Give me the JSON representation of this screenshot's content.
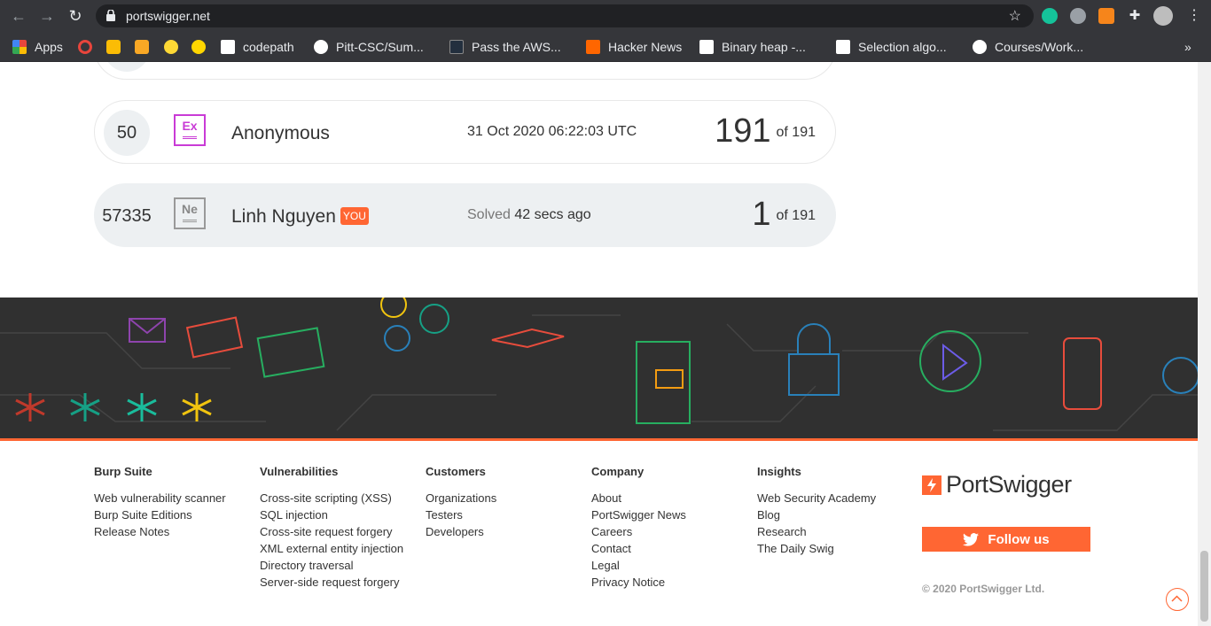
{
  "browser": {
    "url": "portswigger.net",
    "bookmarks": [
      {
        "label": "Apps",
        "color": "#e8453c"
      },
      {
        "label": "codepath",
        "color": "#ffffff"
      },
      {
        "label": "Pitt-CSC/Sum...",
        "color": "#ffffff"
      },
      {
        "label": "Pass the AWS...",
        "color": "#232f3e"
      },
      {
        "label": "Hacker News",
        "color": "#ff6600"
      },
      {
        "label": "Binary heap -...",
        "color": "#ffffff"
      },
      {
        "label": "Selection algo...",
        "color": "#ffffff"
      },
      {
        "label": "Courses/Work...",
        "color": "#ffffff"
      }
    ],
    "overflow": "»"
  },
  "leaderboard": [
    {
      "rank": "50",
      "level": "Ex",
      "name": "Anonymous",
      "badge": "",
      "time_prefix": "",
      "time": "31 Oct 2020 06:22:03 UTC",
      "position": "191",
      "of": "of 191"
    },
    {
      "rank": "57335",
      "level": "Ne",
      "name": "Linh Nguyen",
      "badge": "YOU",
      "time_prefix": "Solved",
      "time": "42 secs ago",
      "position": "1",
      "of": "of 191"
    }
  ],
  "footer": {
    "columns": [
      {
        "title": "Burp Suite",
        "links": [
          "Web vulnerability scanner",
          "Burp Suite Editions",
          "Release Notes"
        ]
      },
      {
        "title": "Vulnerabilities",
        "links": [
          "Cross-site scripting (XSS)",
          "SQL injection",
          "Cross-site request forgery",
          "XML external entity injection",
          "Directory traversal",
          "Server-side request forgery"
        ]
      },
      {
        "title": "Customers",
        "links": [
          "Organizations",
          "Testers",
          "Developers"
        ]
      },
      {
        "title": "Company",
        "links": [
          "About",
          "PortSwigger News",
          "Careers",
          "Contact",
          "Legal",
          "Privacy Notice"
        ]
      },
      {
        "title": "Insights",
        "links": [
          "Web Security Academy",
          "Blog",
          "Research",
          "The Daily Swig"
        ]
      }
    ],
    "brand": "PortSwigger",
    "follow_label": "Follow us",
    "copyright": "© 2020 PortSwigger Ltd.",
    "accent": "#ff6633"
  }
}
